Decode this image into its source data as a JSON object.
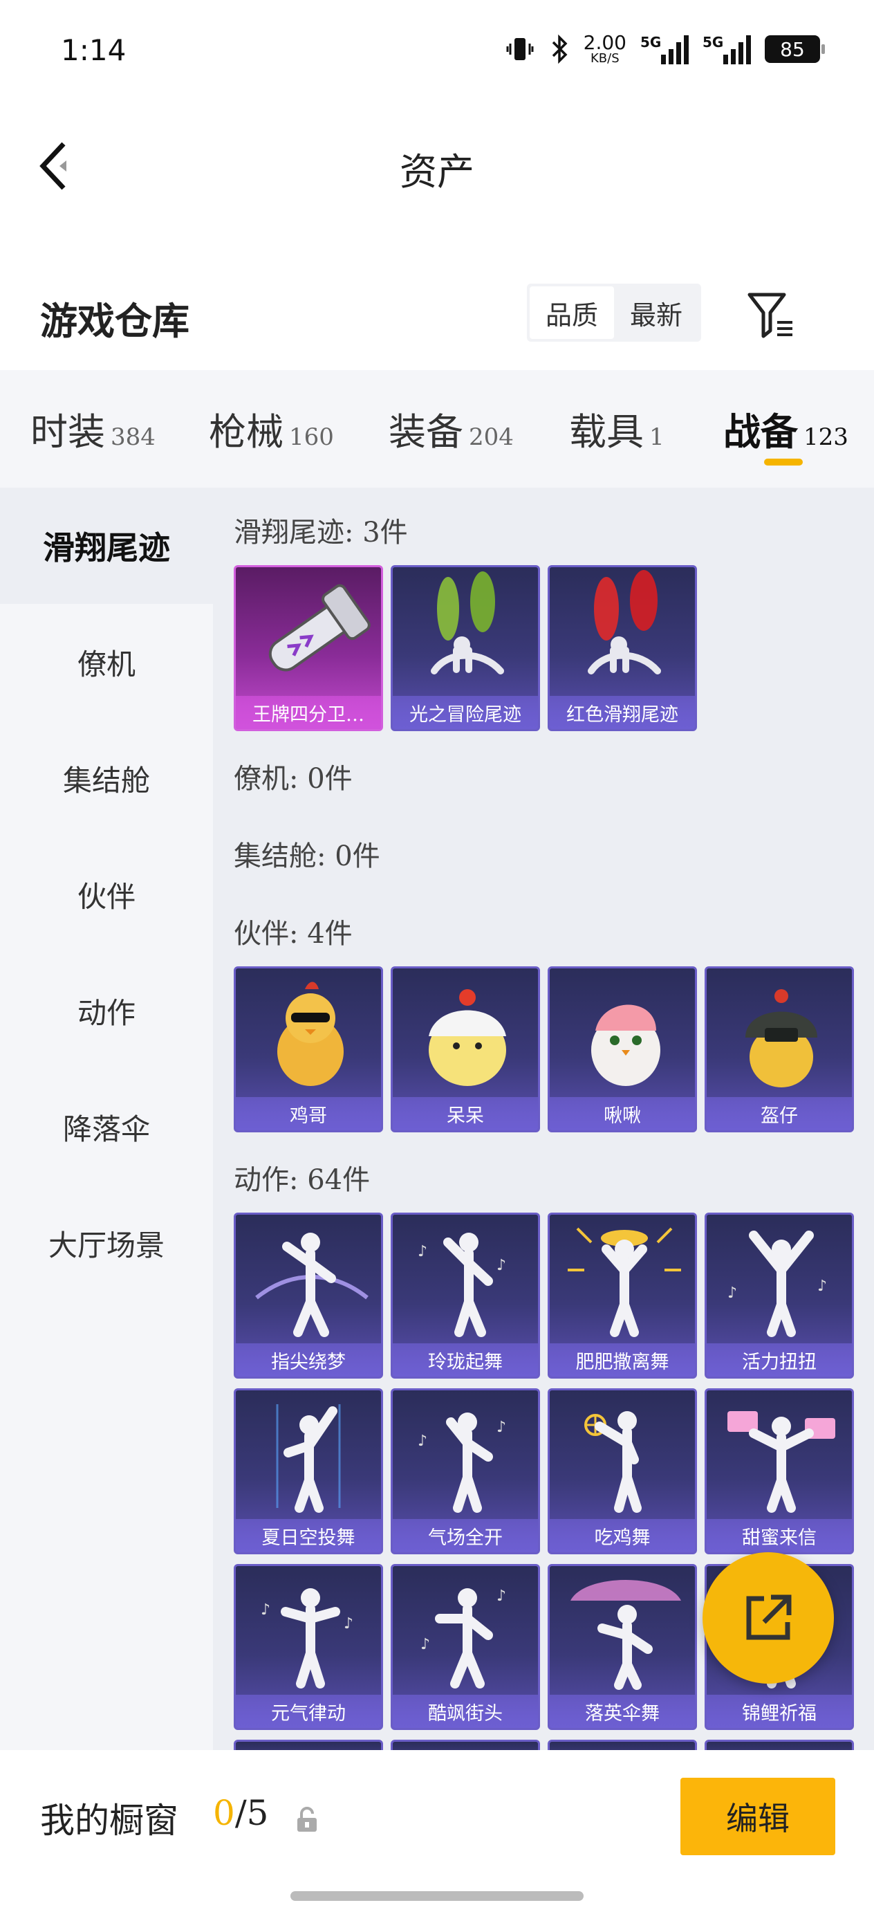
{
  "status_bar": {
    "time": "1:14",
    "net_speed": "2.00",
    "net_unit": "KB/S",
    "sig1": "5G",
    "sig2": "5G",
    "battery": "85"
  },
  "header": {
    "title": "资产"
  },
  "section": {
    "title": "游戏仓库",
    "sort_options": [
      "品质",
      "最新"
    ],
    "active_sort": "品质"
  },
  "tabs": [
    {
      "label": "时装",
      "count": "384"
    },
    {
      "label": "枪械",
      "count": "160"
    },
    {
      "label": "装备",
      "count": "204"
    },
    {
      "label": "载具",
      "count": "1"
    },
    {
      "label": "战备",
      "count": "123"
    }
  ],
  "active_tab": "战备",
  "sidebar": {
    "items": [
      "滑翔尾迹",
      "僚机",
      "集结舱",
      "伙伴",
      "动作",
      "降落伞",
      "大厅场景"
    ],
    "active": "滑翔尾迹"
  },
  "categories": {
    "glide": {
      "heading": "滑翔尾迹: 3件",
      "items": [
        "王牌四分卫…",
        "光之冒险尾迹",
        "红色滑翔尾迹"
      ]
    },
    "wingman": {
      "heading": "僚机: 0件"
    },
    "pod": {
      "heading": "集结舱: 0件"
    },
    "buddy": {
      "heading": "伙伴: 4件",
      "items": [
        "鸡哥",
        "呆呆",
        "啾啾",
        "盔仔"
      ]
    },
    "emote": {
      "heading": "动作: 64件",
      "items": [
        "指尖绕梦",
        "玲珑起舞",
        "肥肥撒离舞",
        "活力扭扭",
        "夏日空投舞",
        "气场全开",
        "吃鸡舞",
        "甜蜜来信",
        "元气律动",
        "酷飒街头",
        "落英伞舞",
        "锦鲤祈福"
      ]
    }
  },
  "bottom": {
    "label": "我的橱窗",
    "count_current": "0",
    "count_total": "/5",
    "edit_label": "编辑"
  },
  "colors": {
    "accent": "#f5b400",
    "card_purple": "#5a4fb0",
    "card_rare": "#c44ccf"
  }
}
